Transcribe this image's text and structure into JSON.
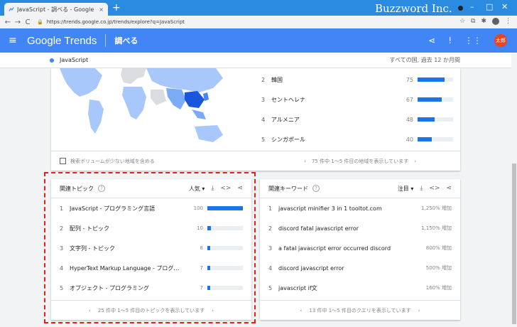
{
  "browser": {
    "tab_title": "JavaScript - 調べる - Google トレンド",
    "tab_close": "×",
    "new_tab": "+",
    "brand": "Buzzword Inc.",
    "url": "https://trends.google.co.jp/trends/explore?q=JavaScript",
    "nav_back": "←",
    "nav_forward": "→",
    "nav_reload": "C",
    "lock": "🔒",
    "win_min": "–",
    "win_max": "□",
    "win_close": "✕",
    "star": "☆",
    "ext": "⧉",
    "puzzle": "✱",
    "more": "⋮"
  },
  "header": {
    "menu_icon": "≡",
    "logo": "Google Trends",
    "section": "調べる",
    "share_icon": "share-icon",
    "feedback_icon": "feedback-icon",
    "apps_icon": "apps-icon",
    "avatar": "太郎",
    "share_glyph": "⋖",
    "feedback_glyph": "!",
    "apps_glyph": "⋮⋮"
  },
  "search": {
    "term": "JavaScript",
    "meta": "すべての国, 過去 12 か月間"
  },
  "geo": {
    "rows": [
      {
        "rank": "2",
        "name": "韓国",
        "value": "75"
      },
      {
        "rank": "3",
        "name": "セントヘレナ",
        "value": "67"
      },
      {
        "rank": "4",
        "name": "アルメニア",
        "value": "48"
      },
      {
        "rank": "5",
        "name": "シンガポール",
        "value": "40"
      }
    ],
    "checkbox_label": "検索ボリュームが少ない地域を含める",
    "pager_text": "75 件中 1～5 件目の地域を表示しています",
    "prev": "‹",
    "next": "›"
  },
  "topics": {
    "title": "関連トピック",
    "help": "?",
    "sort": "人気",
    "sort_arrow": "▾",
    "download": "⤓",
    "embed": "<>",
    "share": "⋖",
    "rows": [
      {
        "rank": "1",
        "name": "JavaScript - プログラミング言語",
        "value": "100"
      },
      {
        "rank": "2",
        "name": "配列 - トピック",
        "value": "10"
      },
      {
        "rank": "3",
        "name": "文字列 - トピック",
        "value": "8"
      },
      {
        "rank": "4",
        "name": "HyperText Markup Language - プログラミング言語",
        "value": "7"
      },
      {
        "rank": "5",
        "name": "オブジェクト - プログラミング",
        "value": "7"
      }
    ],
    "pager_text": "25 件中 1～5 件目のトピックを表示しています",
    "prev": "‹",
    "next": "›"
  },
  "queries": {
    "title": "関連キーワード",
    "help": "?",
    "sort": "注目",
    "sort_arrow": "▾",
    "download": "⤓",
    "embed": "<>",
    "share": "⋖",
    "rows": [
      {
        "rank": "1",
        "name": "javascript minifier 3 in 1 tooltot.com",
        "value": "1,250% 増加"
      },
      {
        "rank": "2",
        "name": "discord fatal javascript error",
        "value": "1,150% 増加"
      },
      {
        "rank": "3",
        "name": "a fatal javascript error occurred discord",
        "value": "800% 増加"
      },
      {
        "rank": "4",
        "name": "discord javascript error",
        "value": "500% 増加"
      },
      {
        "rank": "5",
        "name": "javascript if文",
        "value": "160% 増加"
      }
    ],
    "pager_text": "13 件中 1～5 件目のクエリを表示しています",
    "prev": "‹",
    "next": "›"
  },
  "colors": {
    "accent": "#4285f4",
    "bar": "#1a73e8",
    "highlight": "#e0211a"
  }
}
